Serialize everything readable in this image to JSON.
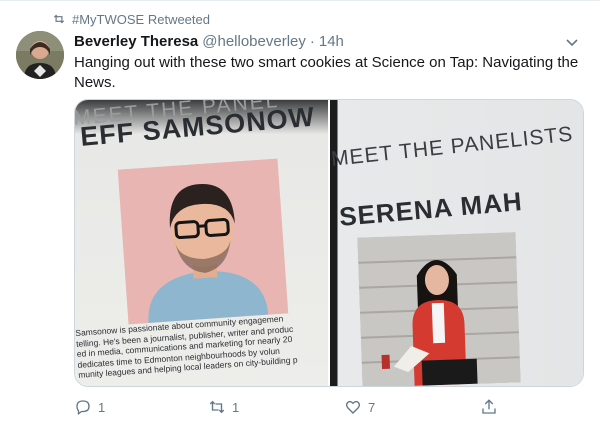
{
  "retweet_context": {
    "label": "#MyTWOSE Retweeted",
    "icon": "retweet-icon"
  },
  "author": {
    "name": "Beverley Theresa",
    "handle": "@hellobeverley",
    "separator": "·",
    "time": "14h"
  },
  "tweet": {
    "text": "Hanging out with these two smart cookies at Science on Tap: Navigating the News."
  },
  "media": {
    "photo1": {
      "meet_text": "MEET THE PANEL",
      "name_text": "EFF SAMSONOW",
      "bio_lines": [
        "Samsonow is passionate about community engagemen",
        "telling. He's been a journalist, publisher, writer and produc",
        "ed in media, communications and marketing for nearly 20",
        "dedicates time to Edmonton neighbourhoods by volun",
        "munity leagues and helping local leaders on city-building p"
      ]
    },
    "photo2": {
      "meet_text": "MEET THE PANELISTS",
      "name_text": "SERENA MAH"
    }
  },
  "actions": {
    "reply": {
      "icon": "reply-icon",
      "count": "1"
    },
    "retweet": {
      "icon": "retweet-icon",
      "count": "1"
    },
    "like": {
      "icon": "heart-icon",
      "count": "7"
    },
    "share": {
      "icon": "share-icon",
      "count": ""
    }
  },
  "colors": {
    "secondary_text": "#657786",
    "primary_text": "#14171a",
    "border": "#ccd6dd"
  }
}
